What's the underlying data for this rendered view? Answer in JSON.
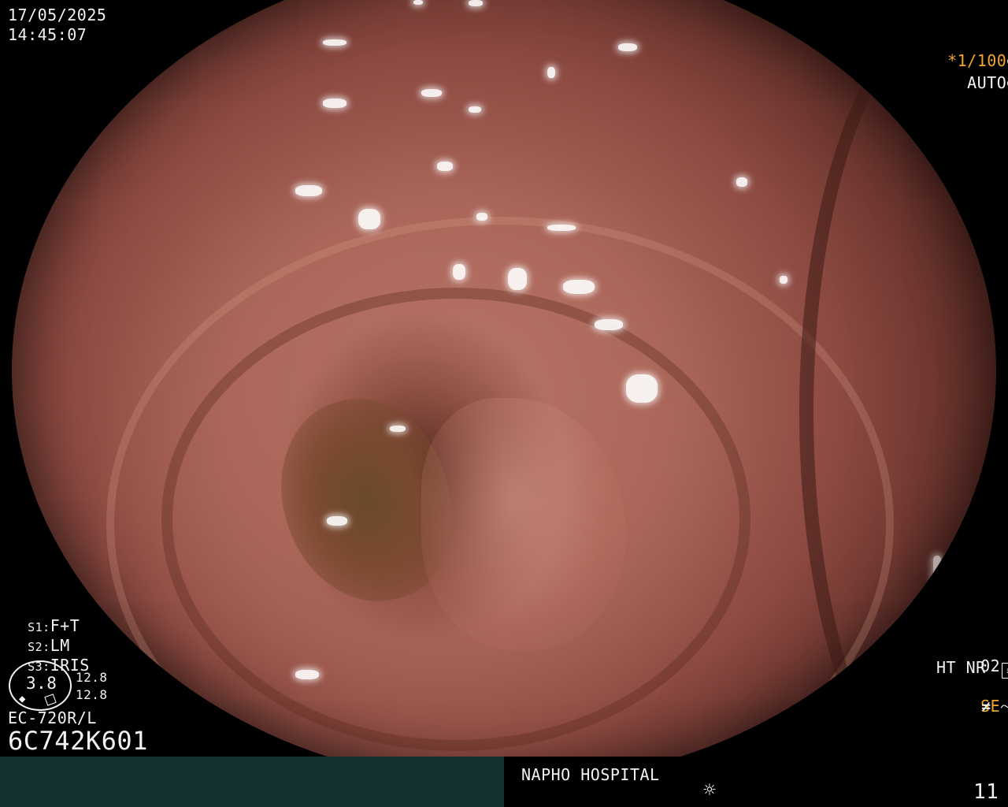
{
  "datetime": {
    "date": "17/05/2025",
    "time": "14:45:07"
  },
  "shutter": {
    "speed": "*1/100",
    "speed_icon": "aperture-icon",
    "mode": "AUTO",
    "mode_icon": "iris-icon"
  },
  "settings": {
    "s1_label": "S1:",
    "s1_value": "F+T",
    "s2_label": "S2:",
    "s2_value": "LM",
    "s3_label": "S3:",
    "s3_value": "IRIS"
  },
  "gauge": {
    "value": "3.8",
    "upper": "12.8",
    "lower": "12.8"
  },
  "scope": {
    "model": "EC-720R/L",
    "serial": "6C742K601"
  },
  "right_status": {
    "o2": "02",
    "ht_nr": "HT NR",
    "se": "SE",
    "se_icon": "enhance-icon",
    "flicker_icon": "not-equal-icon"
  },
  "footer": {
    "hospital": "NAPHO HOSPITAL",
    "light_icon": "sun-icon",
    "frame_number": "11"
  },
  "colors": {
    "accent": "#f2a52a",
    "bar": "#143030",
    "mucosa": "#a86458"
  }
}
